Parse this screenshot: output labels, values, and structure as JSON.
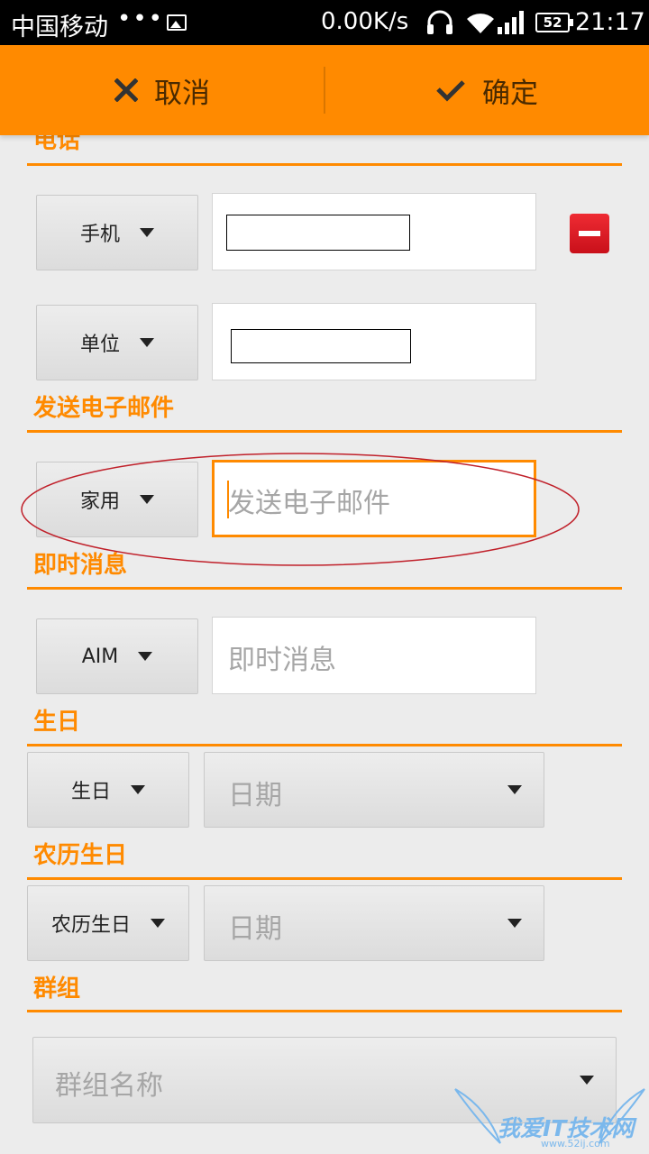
{
  "status_bar": {
    "carrier": "中国移动",
    "dots": "•••",
    "speed": "0.00K/s",
    "battery": "52",
    "time": "21:17"
  },
  "action_bar": {
    "cancel_label": "取消",
    "confirm_label": "确定",
    "accent": "#ff8a00"
  },
  "phone": {
    "title": "电话",
    "rows": [
      {
        "type": "手机"
      },
      {
        "type": "单位"
      }
    ]
  },
  "email": {
    "title": "发送电子邮件",
    "type": "家用",
    "placeholder": "发送电子邮件"
  },
  "im": {
    "title": "即时消息",
    "type": "AIM",
    "placeholder": "即时消息"
  },
  "birthday": {
    "title": "生日",
    "type": "生日",
    "date_placeholder": "日期"
  },
  "lunar_birthday": {
    "title": "农历生日",
    "type": "农历生日",
    "date_placeholder": "日期"
  },
  "group": {
    "title": "群组",
    "placeholder": "群组名称"
  },
  "watermark": {
    "text": "我爱IT技术网",
    "url": "www.52ij.com"
  }
}
